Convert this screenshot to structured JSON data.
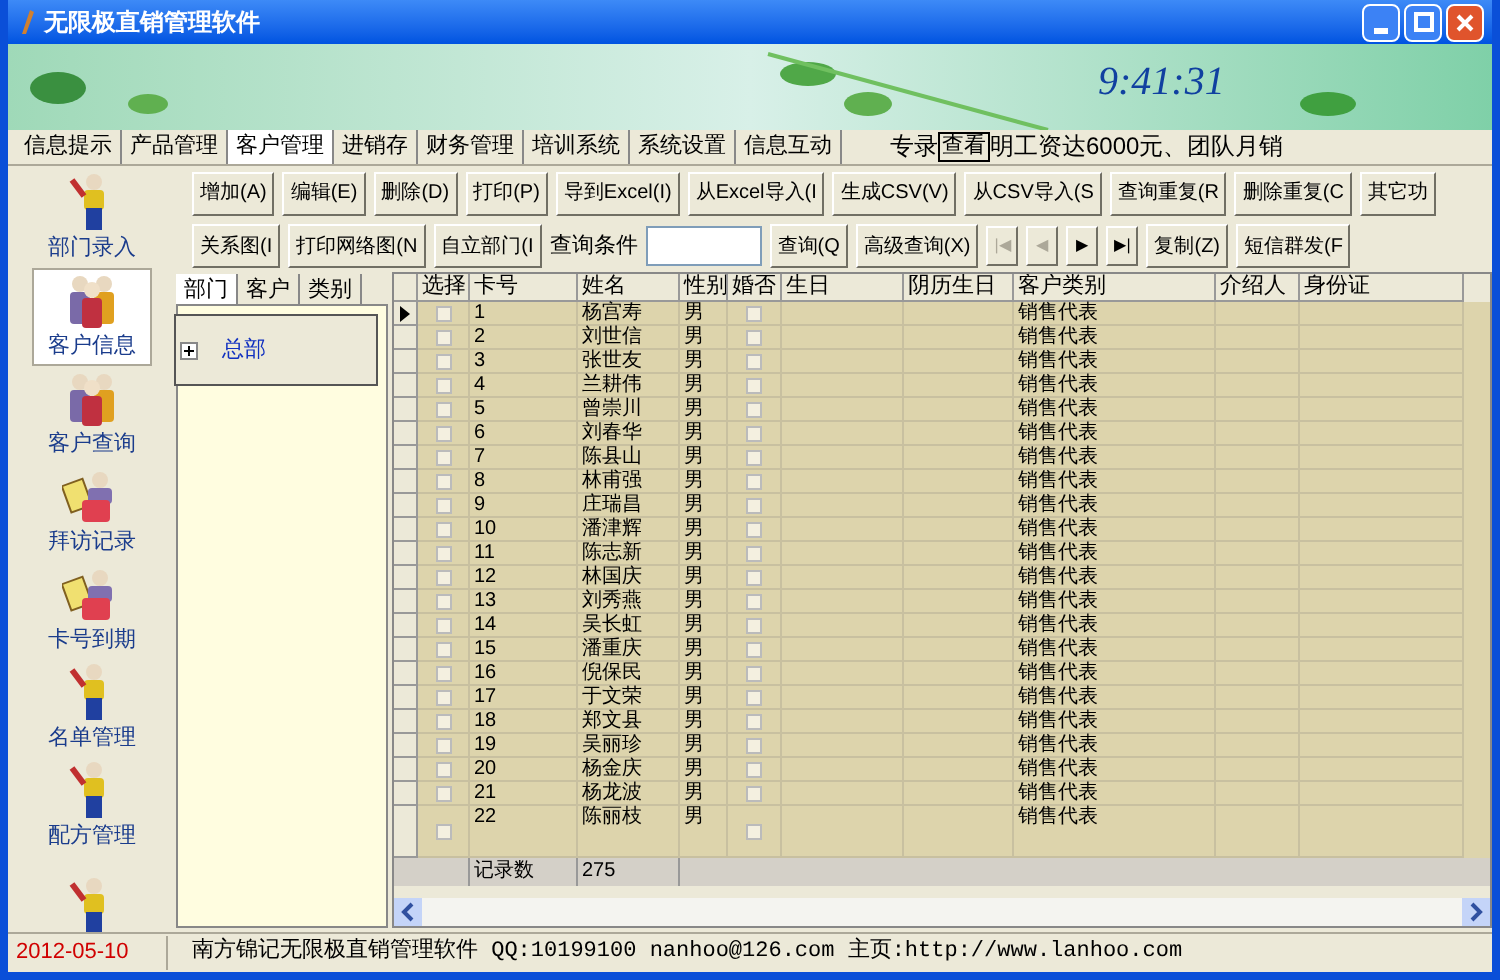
{
  "window": {
    "title": "无限极直销管理软件"
  },
  "banner": {
    "clock": "9:41:31"
  },
  "menu_tabs": [
    {
      "label": "信息提示",
      "selected": false
    },
    {
      "label": "产品管理",
      "selected": false
    },
    {
      "label": "客户管理",
      "selected": true
    },
    {
      "label": "进销存",
      "selected": false
    },
    {
      "label": "财务管理",
      "selected": false
    },
    {
      "label": "培训系统",
      "selected": false
    },
    {
      "label": "系统设置",
      "selected": false
    },
    {
      "label": "信息互动",
      "selected": false
    }
  ],
  "ticker": {
    "before": "专录",
    "button": "查看",
    "after": "明工资达6000元、团队月销"
  },
  "sidebar": {
    "items": [
      {
        "label": "部门录入",
        "kind": "worker",
        "selected": false
      },
      {
        "label": "客户信息",
        "kind": "group",
        "selected": true
      },
      {
        "label": "客户查询",
        "kind": "group",
        "selected": false
      },
      {
        "label": "拜访记录",
        "kind": "visitor",
        "selected": false
      },
      {
        "label": "卡号到期",
        "kind": "visitor",
        "selected": false
      },
      {
        "label": "名单管理",
        "kind": "worker",
        "selected": false
      },
      {
        "label": "配方管理",
        "kind": "worker",
        "selected": false
      },
      {
        "kind": "worker",
        "selected": false
      }
    ]
  },
  "toolbar": {
    "row_1": [
      {
        "kind": "button",
        "label": "增加(A)"
      },
      {
        "kind": "button",
        "label": "编辑(E)"
      },
      {
        "kind": "button",
        "label": "删除(D)"
      },
      {
        "kind": "button",
        "label": "打印(P)"
      },
      {
        "kind": "button",
        "label": "导到Excel(I)"
      },
      {
        "kind": "button",
        "label": "从Excel导入(I"
      },
      {
        "kind": "button",
        "label": "生成CSV(V)"
      },
      {
        "kind": "button",
        "label": "从CSV导入(S"
      },
      {
        "kind": "button",
        "label": "查询重复(R"
      },
      {
        "kind": "button",
        "label": "删除重复(C"
      },
      {
        "kind": "button",
        "label": "其它功"
      }
    ],
    "row_2": [
      {
        "kind": "button",
        "label": "关系图(I"
      },
      {
        "kind": "button",
        "label": "打印网络图(N"
      },
      {
        "kind": "button",
        "label": "自立部门(I"
      },
      {
        "kind": "label",
        "label": "查询条件"
      },
      {
        "kind": "input"
      },
      {
        "kind": "button",
        "label": "查询(Q"
      },
      {
        "kind": "button",
        "label": "高级查询(X)"
      },
      {
        "kind": "nav",
        "label": "|◀",
        "disabled": true
      },
      {
        "kind": "nav",
        "label": "◀",
        "disabled": true
      },
      {
        "kind": "nav",
        "label": "▶",
        "disabled": false
      },
      {
        "kind": "nav",
        "label": "▶|",
        "disabled": false
      },
      {
        "kind": "button",
        "label": "复制(Z)"
      },
      {
        "kind": "button",
        "label": "短信群发(F"
      }
    ]
  },
  "left_panel": {
    "tabs": [
      {
        "label": "部门",
        "selected": true
      },
      {
        "label": "客户",
        "selected": false
      },
      {
        "label": "类别",
        "selected": false
      }
    ],
    "tree": [
      {
        "label": "总部",
        "expanded": false
      }
    ]
  },
  "table": {
    "columns": [
      "选择",
      "卡号",
      "姓名",
      "性别",
      "婚否",
      "生日",
      "阴历生日",
      "客户类别",
      "介绍人",
      "身份证"
    ],
    "rows": [
      {
        "current": true,
        "checked": false,
        "card": "1",
        "name": "杨宫寿",
        "gender": "男",
        "married": false,
        "category": "销售代表"
      },
      {
        "current": false,
        "checked": false,
        "card": "2",
        "name": "刘世信",
        "gender": "男",
        "married": false,
        "category": "销售代表"
      },
      {
        "current": false,
        "checked": false,
        "card": "3",
        "name": "张世友",
        "gender": "男",
        "married": false,
        "category": "销售代表"
      },
      {
        "current": false,
        "checked": false,
        "card": "4",
        "name": "兰耕伟",
        "gender": "男",
        "married": false,
        "category": "销售代表"
      },
      {
        "current": false,
        "checked": false,
        "card": "5",
        "name": "曾崇川",
        "gender": "男",
        "married": false,
        "category": "销售代表"
      },
      {
        "current": false,
        "checked": false,
        "card": "6",
        "name": "刘春华",
        "gender": "男",
        "married": false,
        "category": "销售代表"
      },
      {
        "current": false,
        "checked": false,
        "card": "7",
        "name": "陈县山",
        "gender": "男",
        "married": false,
        "category": "销售代表"
      },
      {
        "current": false,
        "checked": false,
        "card": "8",
        "name": "林甫强",
        "gender": "男",
        "married": false,
        "category": "销售代表"
      },
      {
        "current": false,
        "checked": false,
        "card": "9",
        "name": "庄瑞昌",
        "gender": "男",
        "married": false,
        "category": "销售代表"
      },
      {
        "current": false,
        "checked": false,
        "card": "10",
        "name": "潘津辉",
        "gender": "男",
        "married": false,
        "category": "销售代表"
      },
      {
        "current": false,
        "checked": false,
        "card": "11",
        "name": "陈志新",
        "gender": "男",
        "married": false,
        "category": "销售代表"
      },
      {
        "current": false,
        "checked": false,
        "card": "12",
        "name": "林国庆",
        "gender": "男",
        "married": false,
        "category": "销售代表"
      },
      {
        "current": false,
        "checked": false,
        "card": "13",
        "name": "刘秀燕",
        "gender": "男",
        "married": false,
        "category": "销售代表"
      },
      {
        "current": false,
        "checked": false,
        "card": "14",
        "name": "吴长虹",
        "gender": "男",
        "married": false,
        "category": "销售代表"
      },
      {
        "current": false,
        "checked": false,
        "card": "15",
        "name": "潘重庆",
        "gender": "男",
        "married": false,
        "category": "销售代表"
      },
      {
        "current": false,
        "checked": false,
        "card": "16",
        "name": "倪保民",
        "gender": "男",
        "married": false,
        "category": "销售代表"
      },
      {
        "current": false,
        "checked": false,
        "card": "17",
        "name": "于文荣",
        "gender": "男",
        "married": false,
        "category": "销售代表"
      },
      {
        "current": false,
        "checked": false,
        "card": "18",
        "name": "郑文县",
        "gender": "男",
        "married": false,
        "category": "销售代表"
      },
      {
        "current": false,
        "checked": false,
        "card": "19",
        "name": "吴丽珍",
        "gender": "男",
        "married": false,
        "category": "销售代表"
      },
      {
        "current": false,
        "checked": false,
        "card": "20",
        "name": "杨金庆",
        "gender": "男",
        "married": false,
        "category": "销售代表"
      },
      {
        "current": false,
        "checked": false,
        "card": "21",
        "name": "杨龙波",
        "gender": "男",
        "married": false,
        "category": "销售代表"
      },
      {
        "current": false,
        "checked": false,
        "card": "22",
        "name": "陈丽枝",
        "gender": "男",
        "married": false,
        "category": "销售代表"
      }
    ],
    "footer": {
      "label": "记录数",
      "count": "275"
    }
  },
  "status_bar": {
    "date": "2012-05-10",
    "info": "南方锦记无限极直销管理软件 QQ:10199100 nanhoo@126.com 主页:http://www.lanhoo.com"
  }
}
